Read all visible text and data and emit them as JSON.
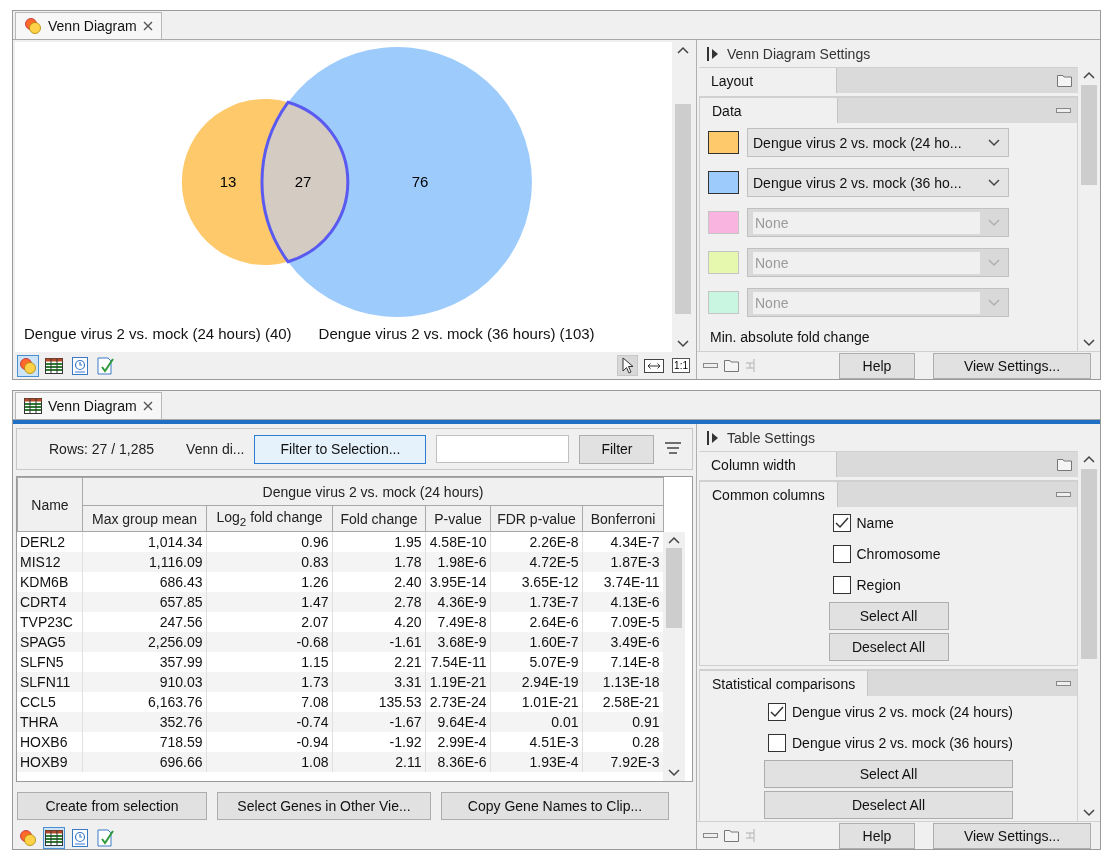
{
  "venn_view": {
    "tab": {
      "label": "Venn Diagram"
    },
    "sets": [
      {
        "name": "Dengue virus 2 vs. mock (24 hours) (40)",
        "color": "#fdc96b",
        "unique": "13"
      },
      {
        "name": "Dengue virus 2 vs. mock (36 hours) (103)",
        "color": "#9ccbfc",
        "unique": "76"
      }
    ],
    "overlap": "27",
    "view_buttons": [
      {
        "kind": "venn",
        "selected": true
      },
      {
        "kind": "table",
        "selected": false
      },
      {
        "kind": "history",
        "selected": false
      },
      {
        "kind": "annotation",
        "selected": false
      }
    ],
    "tools": [
      {
        "kind": "pointer",
        "selected": true
      },
      {
        "kind": "fit",
        "selected": false
      },
      {
        "kind": "actual",
        "label": "1:1",
        "selected": false
      }
    ]
  },
  "venn_settings": {
    "title": "Venn Diagram Settings",
    "sections": [
      {
        "title": "Layout",
        "expanded": false
      },
      {
        "title": "Data",
        "expanded": true,
        "rows": [
          {
            "color": "#fdc96b",
            "value": "Dengue virus 2 vs. mock (24 ho...",
            "disabled": false
          },
          {
            "color": "#9ccbfc",
            "value": "Dengue virus 2 vs. mock (36 ho...",
            "disabled": false
          },
          {
            "color": "#f9b5e0",
            "value": "None",
            "disabled": true
          },
          {
            "color": "#e5f8ae",
            "value": "None",
            "disabled": true
          },
          {
            "color": "#c9f6e1",
            "value": "None",
            "disabled": true
          }
        ],
        "note": "Min. absolute fold change"
      }
    ],
    "buttons": [
      "Help",
      "View Settings..."
    ]
  },
  "table_view": {
    "tab": {
      "label": "Venn Diagram"
    },
    "rows_count": "Rows: 27 / 1,285",
    "filter_label": "Venn di...",
    "selection_button": {
      "label": "Filter to Selection...",
      "highlighted": true
    },
    "filter_button": "Filter",
    "group_header": "Dengue virus 2 vs. mock (24 hours)",
    "columns": [
      "Name",
      "Max group mean",
      "Log$_{2}$ fold change",
      "Fold change",
      "P-value",
      "FDR p-value",
      "Bonferroni"
    ],
    "rows": [
      [
        "DERL2",
        "1,014.34",
        "0.96",
        "1.95",
        "4.58E-10",
        "2.26E-8",
        "4.34E-7"
      ],
      [
        "MIS12",
        "1,116.09",
        "0.83",
        "1.78",
        "1.98E-6",
        "4.72E-5",
        "1.87E-3"
      ],
      [
        "KDM6B",
        "686.43",
        "1.26",
        "2.40",
        "3.95E-14",
        "3.65E-12",
        "3.74E-11"
      ],
      [
        "CDRT4",
        "657.85",
        "1.47",
        "2.78",
        "4.36E-9",
        "1.73E-7",
        "4.13E-6"
      ],
      [
        "TVP23C",
        "247.56",
        "2.07",
        "4.20",
        "7.49E-8",
        "2.64E-6",
        "7.09E-5"
      ],
      [
        "SPAG5",
        "2,256.09",
        "-0.68",
        "-1.61",
        "3.68E-9",
        "1.60E-7",
        "3.49E-6"
      ],
      [
        "SLFN5",
        "357.99",
        "1.15",
        "2.21",
        "7.54E-11",
        "5.07E-9",
        "7.14E-8"
      ],
      [
        "SLFN11",
        "910.03",
        "1.73",
        "3.31",
        "1.19E-21",
        "2.94E-19",
        "1.13E-18"
      ],
      [
        "CCL5",
        "6,163.76",
        "7.08",
        "135.53",
        "2.73E-24",
        "1.01E-21",
        "2.58E-21"
      ],
      [
        "THRA",
        "352.76",
        "-0.74",
        "-1.67",
        "9.64E-4",
        "0.01",
        "0.91"
      ],
      [
        "HOXB6",
        "718.59",
        "-0.94",
        "-1.92",
        "2.99E-4",
        "4.51E-3",
        "0.28"
      ],
      [
        "HOXB9",
        "696.66",
        "1.08",
        "2.11",
        "8.36E-6",
        "1.93E-4",
        "7.92E-3"
      ]
    ],
    "buttons": [
      "Create from selection",
      "Select Genes in Other Vie...",
      "Copy Gene Names to Clip..."
    ],
    "view_buttons": [
      {
        "kind": "venn",
        "selected": false
      },
      {
        "kind": "table",
        "selected": true
      },
      {
        "kind": "history",
        "selected": false
      },
      {
        "kind": "annotation",
        "selected": false
      }
    ]
  },
  "table_settings": {
    "title": "Table Settings",
    "sections": [
      {
        "title": "Column width",
        "expanded": false
      },
      {
        "title": "Common columns",
        "expanded": true,
        "options": [
          {
            "label": "Name",
            "checked": true
          },
          {
            "label": "Chromosome",
            "checked": false
          },
          {
            "label": "Region",
            "checked": false
          }
        ],
        "buttons": [
          "Select All",
          "Deselect All"
        ]
      },
      {
        "title": "Statistical comparisons",
        "expanded": true,
        "options": [
          {
            "label": "Dengue virus 2 vs. mock (24 hours)",
            "checked": true
          },
          {
            "label": "Dengue virus 2 vs. mock (36 hours)",
            "checked": false
          }
        ],
        "buttons": [
          "Select All",
          "Deselect All"
        ]
      }
    ],
    "buttons": [
      "Help",
      "View Settings..."
    ]
  }
}
